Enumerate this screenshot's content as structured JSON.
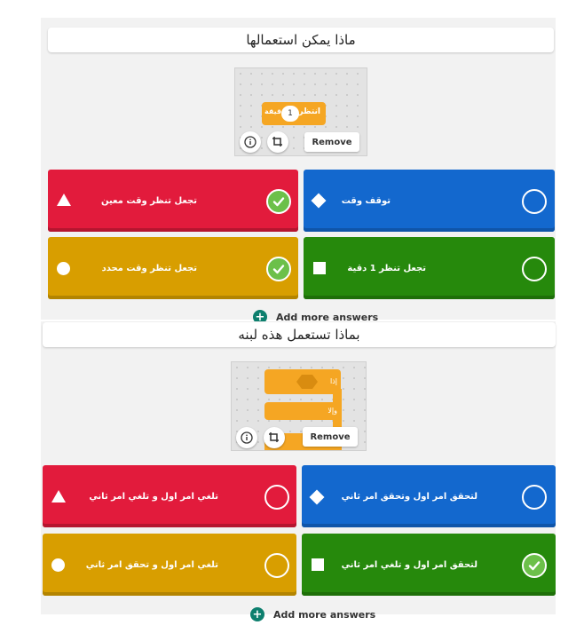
{
  "question1": {
    "title": "ماذا يمكن استعمالها",
    "block_label_left": "انتظر",
    "block_value": "1",
    "block_label_right": "دقيقة",
    "remove_label": "Remove",
    "answers": [
      {
        "text": "تجعل تنظر وقت معين",
        "shape": "triangle-icon",
        "color": "#e21b3c",
        "correct": true
      },
      {
        "text": "توقف وقت",
        "shape": "diamond-icon",
        "color": "#1368ce",
        "correct": false
      },
      {
        "text": "تجعل تنظر وقت محدد",
        "shape": "circle-icon",
        "color": "#d89e00",
        "correct": true
      },
      {
        "text": "تجعل تنظر 1 دقية",
        "shape": "square-icon",
        "color": "#26890c",
        "correct": false
      }
    ],
    "add_more_label": "Add more answers"
  },
  "question2": {
    "title": "بماذا  تستعمل هذه لبنه",
    "block_if_label": "إذا",
    "block_else_label": "وإلا",
    "remove_label": "Remove",
    "answers": [
      {
        "text": "تلغي امر اول و تلغي امر ثاني",
        "shape": "triangle-icon",
        "color": "#e21b3c",
        "correct": false
      },
      {
        "text": "لتحقق امر اول وتحقق امر ثاني",
        "shape": "diamond-icon",
        "color": "#1368ce",
        "correct": false
      },
      {
        "text": "تلغي امر اول و تحقق امر ثاني",
        "shape": "circle-icon",
        "color": "#d89e00",
        "correct": false
      },
      {
        "text": "لتحقق امر اول و تلغي امر ثاني",
        "shape": "square-icon",
        "color": "#26890c",
        "correct": true
      }
    ],
    "add_more_label": "Add more answers"
  }
}
